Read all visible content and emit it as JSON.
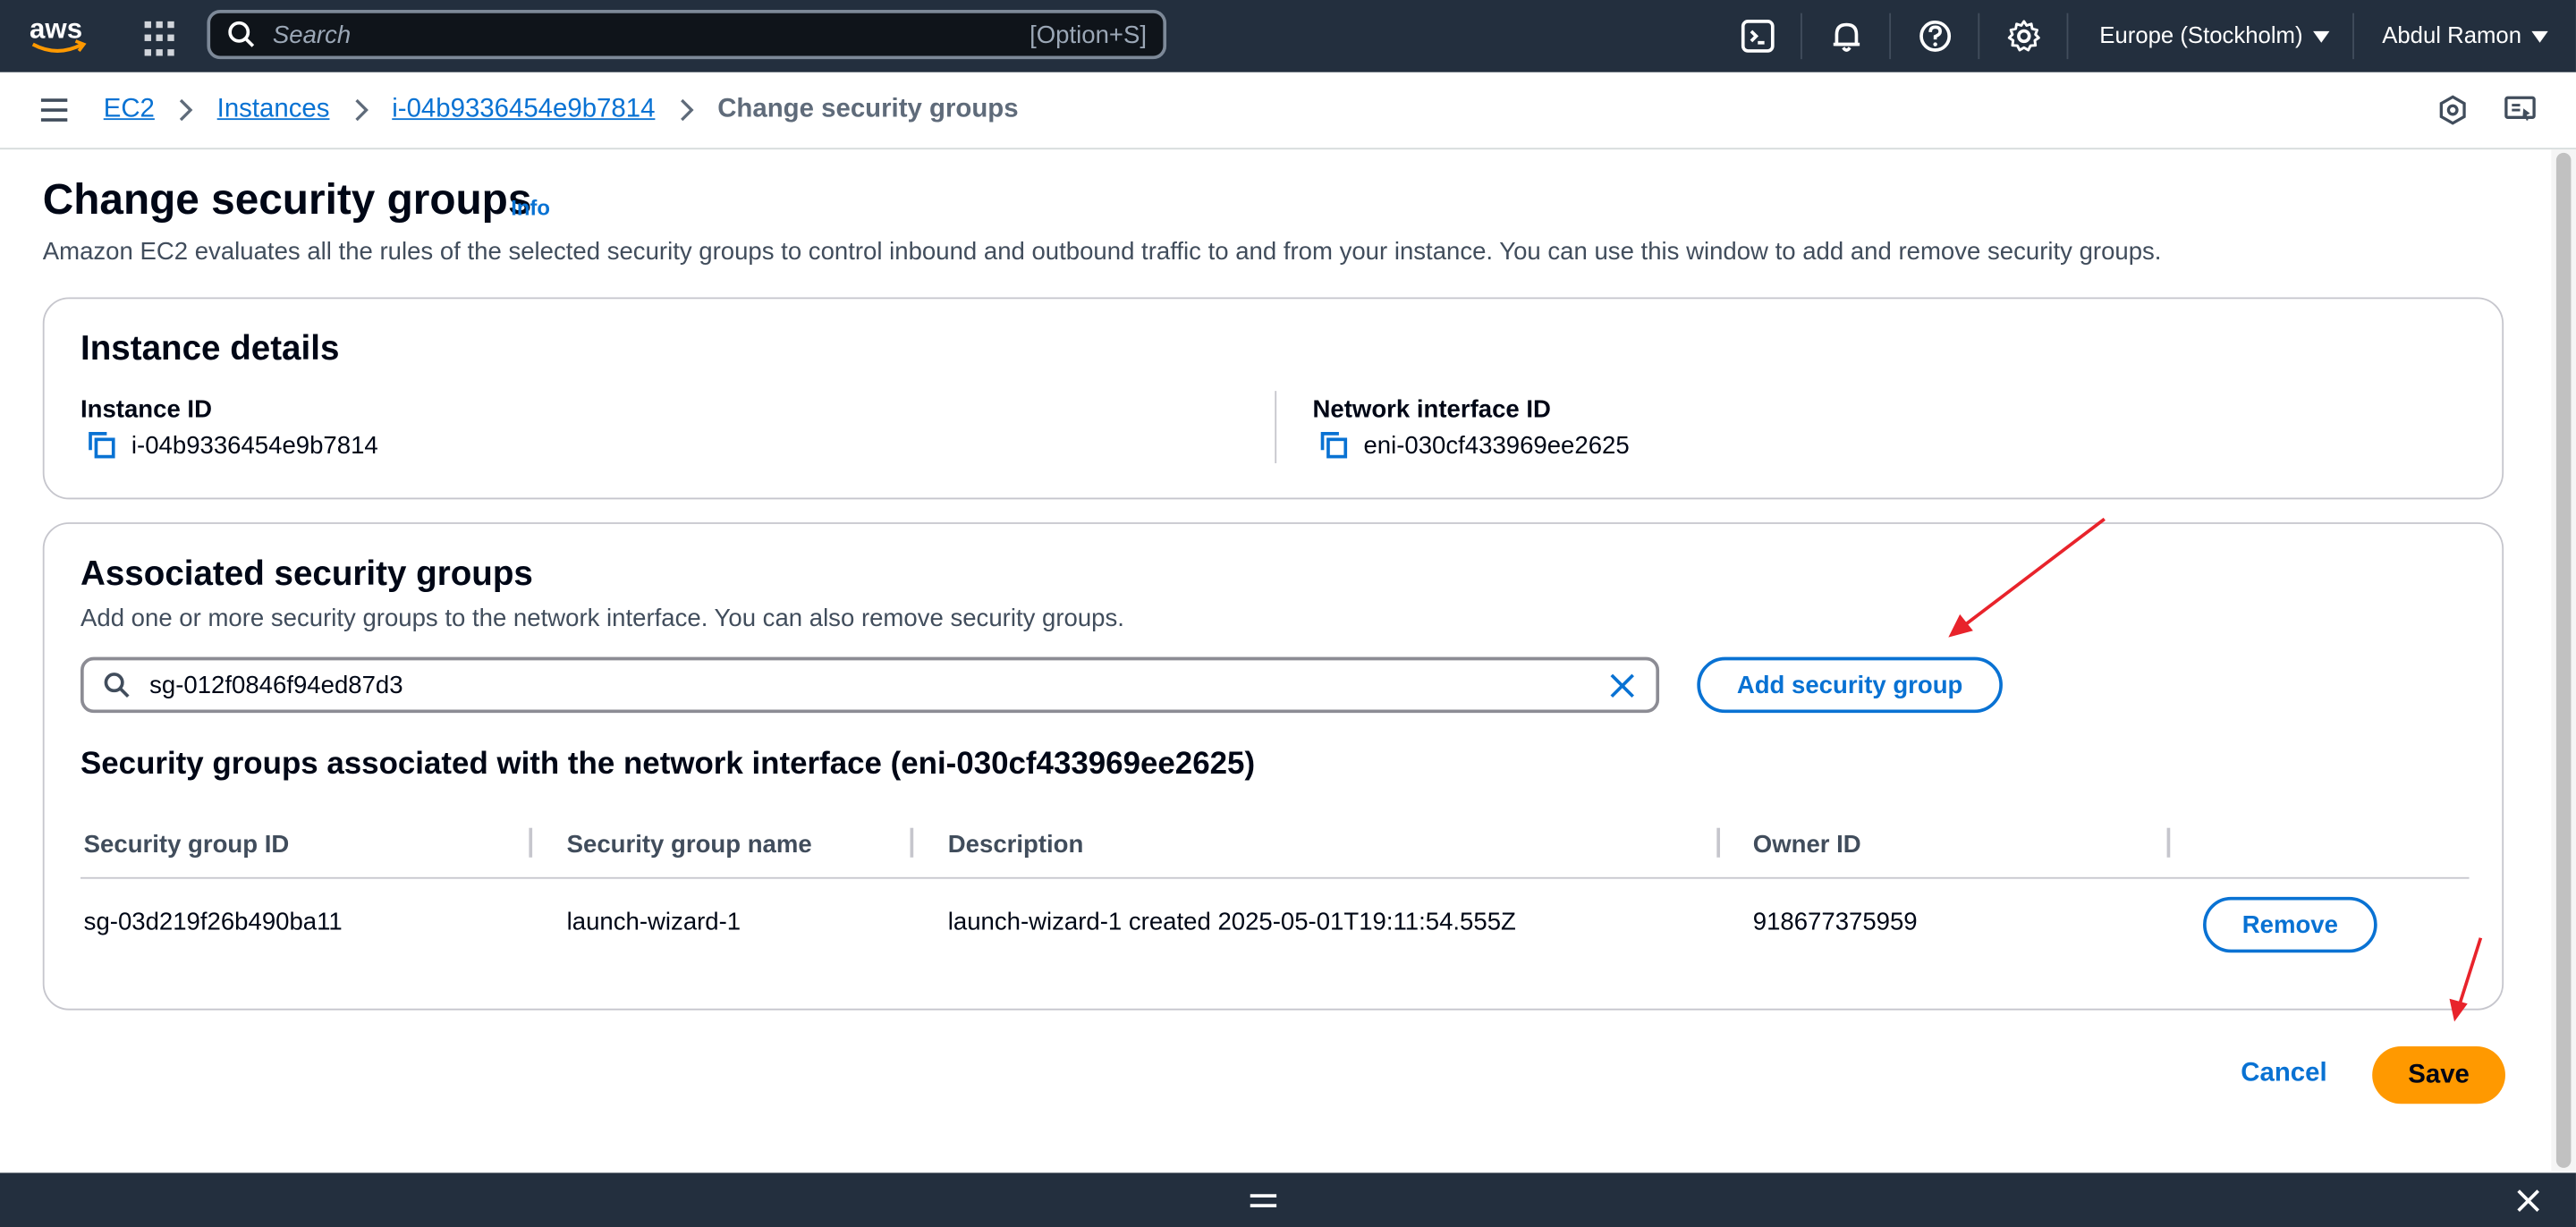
{
  "topnav": {
    "logo": "aws",
    "search_placeholder": "Search",
    "search_shortcut": "[Option+S]",
    "region": "Europe (Stockholm)",
    "user": "Abdul Ramon",
    "icons": [
      "services-grid-icon",
      "cloudshell-icon",
      "notifications-bell-icon",
      "help-icon",
      "settings-gear-icon"
    ]
  },
  "breadcrumb": {
    "items": [
      "EC2",
      "Instances",
      "i-04b9336454e9b7814"
    ],
    "current": "Change security groups"
  },
  "page": {
    "title": "Change security groups",
    "info_link": "Info",
    "description": "Amazon EC2 evaluates all the rules of the selected security groups to control inbound and outbound traffic to and from your instance. You can use this window to add and remove security groups."
  },
  "instance_details": {
    "heading": "Instance details",
    "instance_id_label": "Instance ID",
    "instance_id": "i-04b9336454e9b7814",
    "eni_label": "Network interface ID",
    "eni_id": "eni-030cf433969ee2625"
  },
  "associated": {
    "heading": "Associated security groups",
    "description": "Add one or more security groups to the network interface. You can also remove security groups.",
    "search_value": "sg-012f0846f94ed87d3",
    "add_button": "Add security group",
    "table_title": "Security groups associated with the network interface (eni-030cf433969ee2625)",
    "columns": [
      "Security group ID",
      "Security group name",
      "Description",
      "Owner ID"
    ],
    "rows": [
      {
        "id": "sg-03d219f26b490ba11",
        "name": "launch-wizard-1",
        "description": "launch-wizard-1 created 2025-05-01T19:11:54.555Z",
        "owner": "918677375959",
        "action": "Remove"
      }
    ]
  },
  "footer_actions": {
    "cancel": "Cancel",
    "save": "Save"
  },
  "colors": {
    "nav_bg": "#232f3e",
    "link_blue": "#0972d3",
    "save_orange": "#ff9900",
    "annotation_red": "#e8232b"
  }
}
